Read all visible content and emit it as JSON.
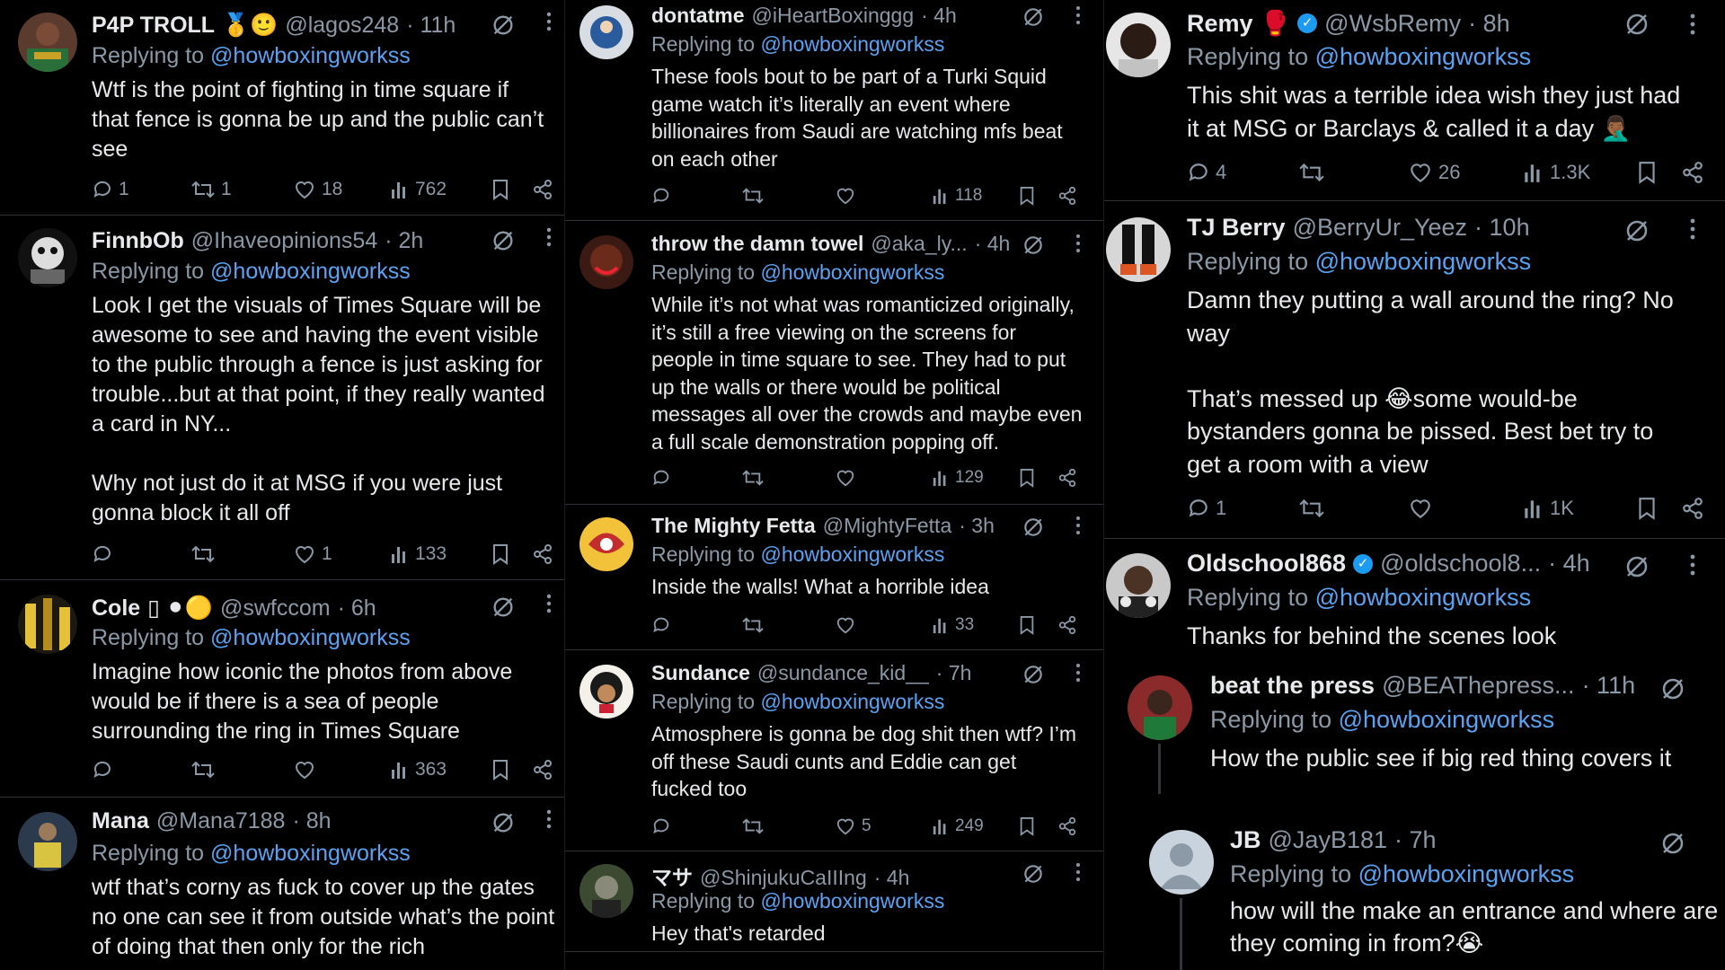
{
  "columns": [
    {
      "tweets": [
        {
          "name": "P4P TROLL",
          "name_suffix": "🥇🙂",
          "handle": "@lagos248",
          "time": "· 11h",
          "reply_prefix": "Replying to",
          "reply_to": "@howboxingworkss",
          "text": "Wtf is the point of fighting in time square if\nthat fence is gonna be up and the public can’t\nsee",
          "replies": "1",
          "reposts": "1",
          "likes": "18",
          "views": "762"
        },
        {
          "name": "FinnbOb",
          "name_suffix": "",
          "handle": "@Ihaveopinions54",
          "time": "· 2h",
          "reply_prefix": "Replying to",
          "reply_to": "@howboxingworkss",
          "text": "Look I get the visuals of Times Square will be\nawesome to see and having the event visible\nto the public through a fence is just asking for\ntrouble...but at that point, if they really wanted\na card in NY...\n\nWhy not just do it at MSG if you were just\ngonna block it all off",
          "replies": "",
          "reposts": "",
          "likes": "1",
          "views": "133"
        },
        {
          "name": "Cole",
          "name_suffix": "▯ ⚫🟡",
          "handle": "@swfccom",
          "time": "· 6h",
          "reply_prefix": "Replying to",
          "reply_to": "@howboxingworkss",
          "text": "Imagine how iconic the photos from above\nwould be if there is a sea of people\nsurrounding the ring in Times Square",
          "replies": "",
          "reposts": "",
          "likes": "",
          "views": "363"
        },
        {
          "name": "Mana",
          "name_suffix": "",
          "handle": "@Mana7188",
          "time": "· 8h",
          "reply_prefix": "Replying to",
          "reply_to": "@howboxingworkss",
          "text": "wtf that’s corny as fuck to cover up the gates\nno one can see it from outside what’s the point\nof doing that then only for the rich",
          "replies": "",
          "reposts": "",
          "likes": "",
          "views": ""
        }
      ]
    },
    {
      "tweets": [
        {
          "name": "dontatme",
          "name_suffix": "",
          "handle": "@iHeartBoxinggg",
          "time": "· 4h",
          "reply_prefix": "Replying to",
          "reply_to": "@howboxingworkss",
          "text": "These fools bout to be part of a Turki Squid\ngame watch it’s literally an event where\nbillionaires from Saudi are watching mfs beat\non each other",
          "replies": "",
          "reposts": "",
          "likes": "",
          "views": "118"
        },
        {
          "name": "throw the damn towel",
          "name_suffix": "",
          "handle": "@aka_ly...",
          "time": "· 4h",
          "reply_prefix": "Replying to",
          "reply_to": "@howboxingworkss",
          "text": "While it’s not what was romanticized originally,\nit’s still a free viewing on the screens for\npeople in time square to see. They had to put\nup the walls or there would be political\nmessages all over the crowds and maybe even\na full scale demonstration popping off.",
          "replies": "",
          "reposts": "",
          "likes": "",
          "views": "129"
        },
        {
          "name": "The Mighty Fetta",
          "name_suffix": "",
          "handle": "@MightyFetta",
          "time": "· 3h",
          "reply_prefix": "Replying to",
          "reply_to": "@howboxingworkss",
          "text": "Inside the walls! What a horrible idea",
          "replies": "",
          "reposts": "",
          "likes": "",
          "views": "33"
        },
        {
          "name": "Sundance",
          "name_suffix": "",
          "handle": "@sundance_kid__",
          "time": "· 7h",
          "reply_prefix": "Replying to",
          "reply_to": "@howboxingworkss",
          "text": "Atmosphere is gonna be dog shit then wtf? I’m\noff these Saudi cunts and Eddie can get\nfucked too",
          "replies": "",
          "reposts": "",
          "likes": "5",
          "views": "249"
        },
        {
          "name": "マサ",
          "name_suffix": "",
          "handle": "@ShinjukuCaIIIng",
          "time": "· 4h",
          "reply_prefix": "Replying to",
          "reply_to": "@howboxingworkss",
          "text": "Hey that's retarded",
          "replies": "",
          "reposts": "",
          "likes": "",
          "views": ""
        }
      ]
    },
    {
      "tweets": [
        {
          "name": "Remy",
          "name_suffix": "🥊",
          "verified": true,
          "handle": "@WsbRemy",
          "time": "· 8h",
          "reply_prefix": "Replying to",
          "reply_to": "@howboxingworkss",
          "text": "This shit was a terrible idea wish they just had\nit at MSG or Barclays & called it a day 🤦🏾‍♂️",
          "replies": "4",
          "reposts": "",
          "likes": "26",
          "views": "1.3K"
        },
        {
          "name": "TJ Berry",
          "name_suffix": "",
          "handle": "@BerryUr_Yeez",
          "time": "· 10h",
          "reply_prefix": "Replying to",
          "reply_to": "@howboxingworkss",
          "text": "Damn they putting a wall around the ring? No\nway\n\nThat’s messed up 😂some would-be\nbystanders gonna be pissed. Best bet try to\nget a room with a view",
          "replies": "1",
          "reposts": "",
          "likes": "",
          "views": "1K"
        },
        {
          "name": "Oldschool868",
          "name_suffix": "",
          "verified": true,
          "handle": "@oldschool8...",
          "time": "· 4h",
          "reply_prefix": "Replying to",
          "reply_to": "@howboxingworkss",
          "text": "Thanks for behind the scenes look"
        },
        {
          "name": "beat the press",
          "name_suffix": "",
          "handle": "@BEAThepress...",
          "time": "· 11h",
          "reply_prefix": "Replying to",
          "reply_to": "@howboxingworkss",
          "text": "How the public see if big red thing covers it"
        },
        {
          "name": "JB",
          "name_suffix": "",
          "handle": "@JayB181",
          "time": "· 7h",
          "reply_prefix": "Replying to",
          "reply_to": "@howboxingworkss",
          "text": "how will the make an entrance and where are\nthey coming in from?😭"
        }
      ]
    }
  ],
  "icons": [
    "reply-icon",
    "repost-icon",
    "like-icon",
    "views-icon",
    "bookmark-icon",
    "share-icon",
    "grok-icon",
    "more-icon"
  ]
}
